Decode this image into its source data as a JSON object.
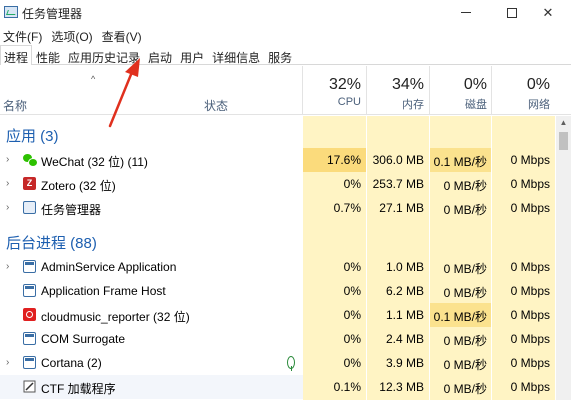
{
  "window": {
    "title": "任务管理器",
    "icon": "task-manager-icon"
  },
  "menu": [
    "文件(F)",
    "选项(O)",
    "查看(V)"
  ],
  "tabs": [
    "进程",
    "性能",
    "应用历史记录",
    "启动",
    "用户",
    "详细信息",
    "服务"
  ],
  "active_tab": "进程",
  "columns": {
    "name": "名称",
    "status": "状态",
    "cpu": {
      "pct": "32%",
      "label": "CPU"
    },
    "memory": {
      "pct": "34%",
      "label": "内存"
    },
    "disk": {
      "pct": "0%",
      "label": "磁盘"
    },
    "network": {
      "pct": "0%",
      "label": "网络"
    }
  },
  "groups": {
    "apps": {
      "label": "应用 (3)"
    },
    "background": {
      "label": "后台进程 (88)"
    }
  },
  "apps": [
    {
      "name": "WeChat (32 位) (11)",
      "cpu": "17.6%",
      "mem": "306.0 MB",
      "disk": "0.1 MB/秒",
      "net": "0 Mbps",
      "icon": "wechat-icon"
    },
    {
      "name": "Zotero (32 位)",
      "cpu": "0%",
      "mem": "253.7 MB",
      "disk": "0 MB/秒",
      "net": "0 Mbps",
      "icon": "zotero-icon"
    },
    {
      "name": "任务管理器",
      "cpu": "0.7%",
      "mem": "27.1 MB",
      "disk": "0 MB/秒",
      "net": "0 Mbps",
      "icon": "task-manager-icon"
    }
  ],
  "background": [
    {
      "name": "AdminService Application",
      "cpu": "0%",
      "mem": "1.0 MB",
      "disk": "0 MB/秒",
      "net": "0 Mbps",
      "icon": "window-icon"
    },
    {
      "name": "Application Frame Host",
      "cpu": "0%",
      "mem": "6.2 MB",
      "disk": "0 MB/秒",
      "net": "0 Mbps",
      "icon": "window-icon"
    },
    {
      "name": "cloudmusic_reporter (32 位)",
      "cpu": "0%",
      "mem": "1.1 MB",
      "disk": "0.1 MB/秒",
      "net": "0 Mbps",
      "icon": "cloudmusic-icon"
    },
    {
      "name": "COM Surrogate",
      "cpu": "0%",
      "mem": "2.4 MB",
      "disk": "0 MB/秒",
      "net": "0 Mbps",
      "icon": "window-icon"
    },
    {
      "name": "Cortana (2)",
      "cpu": "0%",
      "mem": "3.9 MB",
      "disk": "0 MB/秒",
      "net": "0 Mbps",
      "icon": "window-icon"
    },
    {
      "name": "CTF 加载程序",
      "cpu": "0.1%",
      "mem": "12.3 MB",
      "disk": "0 MB/秒",
      "net": "0 Mbps",
      "icon": "ctf-icon"
    }
  ],
  "colors": {
    "heat_light": "#fff4c4",
    "heat_medium": "#fbe28e",
    "heat_strong": "#fbdb7c",
    "group_header": "#1d5fb0",
    "annotation_arrow": "#e0301e"
  }
}
